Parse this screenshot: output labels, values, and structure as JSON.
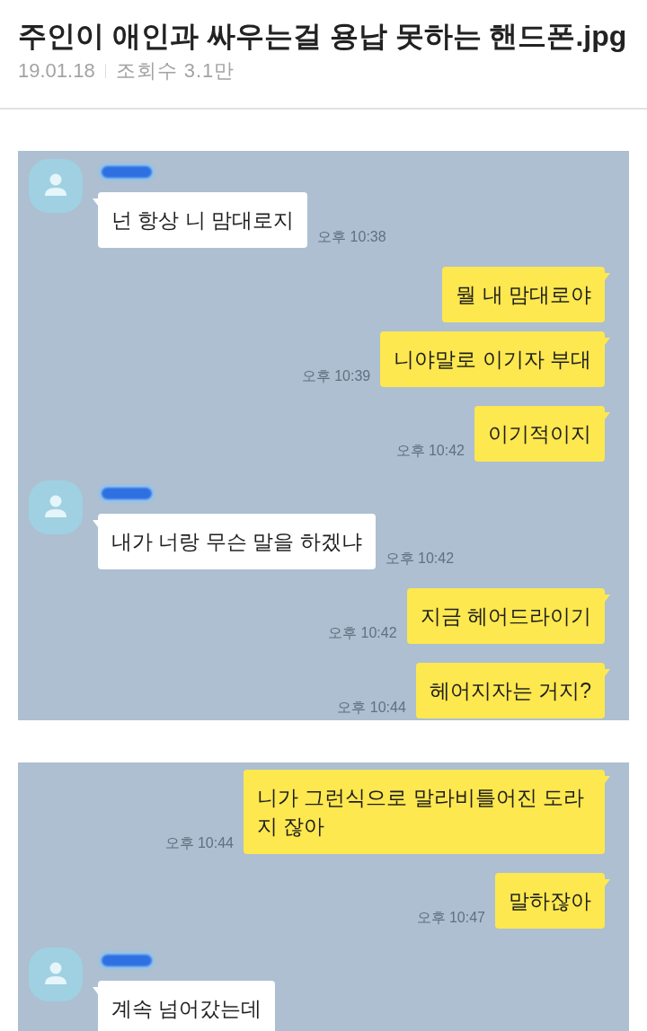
{
  "post": {
    "title": "주인이 애인과 싸우는걸 용납 못하는 핸드폰.jpg",
    "date": "19.01.18",
    "views": "조회수 3.1만"
  },
  "chat_images": [
    {
      "messages": [
        {
          "kind": "incoming",
          "text": "넌 항상 니 맘대로지",
          "time": "오후 10:38"
        },
        {
          "kind": "outgoing",
          "text": "뭘 내 맘대로야"
        },
        {
          "kind": "outgoing",
          "text": "니야말로 이기자 부대",
          "time": "오후 10:39"
        },
        {
          "kind": "outgoing",
          "text": "이기적이지",
          "time": "오후 10:42"
        },
        {
          "kind": "incoming",
          "text": "내가 너랑 무슨 말을 하겠냐",
          "time": "오후 10:42"
        },
        {
          "kind": "outgoing",
          "text": "지금 헤어드라이기",
          "time": "오후 10:42"
        },
        {
          "kind": "outgoing",
          "text": "헤어지자는 거지?",
          "time": "오후 10:44"
        }
      ]
    },
    {
      "messages": [
        {
          "kind": "outgoing",
          "text": "니가 그런식으로 말라비틀어진 도라지 잖아",
          "time": "오후 10:44"
        },
        {
          "kind": "outgoing",
          "text": "말하잖아",
          "time": "오후 10:47"
        },
        {
          "kind": "incoming",
          "text": "계속 넘어갔는데"
        }
      ]
    }
  ]
}
